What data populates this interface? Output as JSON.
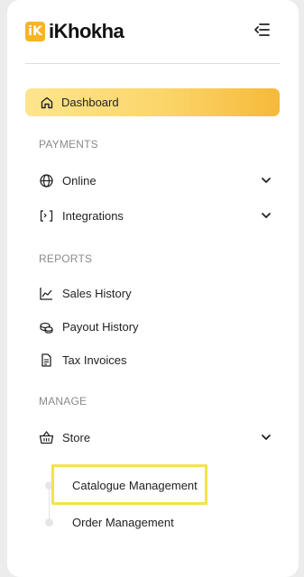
{
  "brand": {
    "logo_letter": "iK",
    "name": "iKhokha"
  },
  "nav": {
    "dashboard": "Dashboard",
    "sections": {
      "payments": "PAYMENTS",
      "reports": "REPORTS",
      "manage": "MANAGE"
    },
    "payments_items": [
      {
        "label": "Online",
        "icon": "globe-icon",
        "expandable": true
      },
      {
        "label": "Integrations",
        "icon": "code-bracket-icon",
        "expandable": true
      }
    ],
    "reports_items": [
      {
        "label": "Sales History",
        "icon": "chart-line-icon"
      },
      {
        "label": "Payout History",
        "icon": "coins-icon"
      },
      {
        "label": "Tax Invoices",
        "icon": "document-icon"
      }
    ],
    "manage_items": [
      {
        "label": "Store",
        "icon": "basket-icon",
        "expandable": true
      }
    ],
    "store_sub_items": [
      {
        "label": "Catalogue Management",
        "highlighted": true
      },
      {
        "label": "Order Management"
      }
    ]
  },
  "colors": {
    "accent_gradient_start": "#fde58f",
    "accent_gradient_end": "#f6b93a",
    "highlight_border": "#f2e34a",
    "logo": "#f7b525"
  }
}
